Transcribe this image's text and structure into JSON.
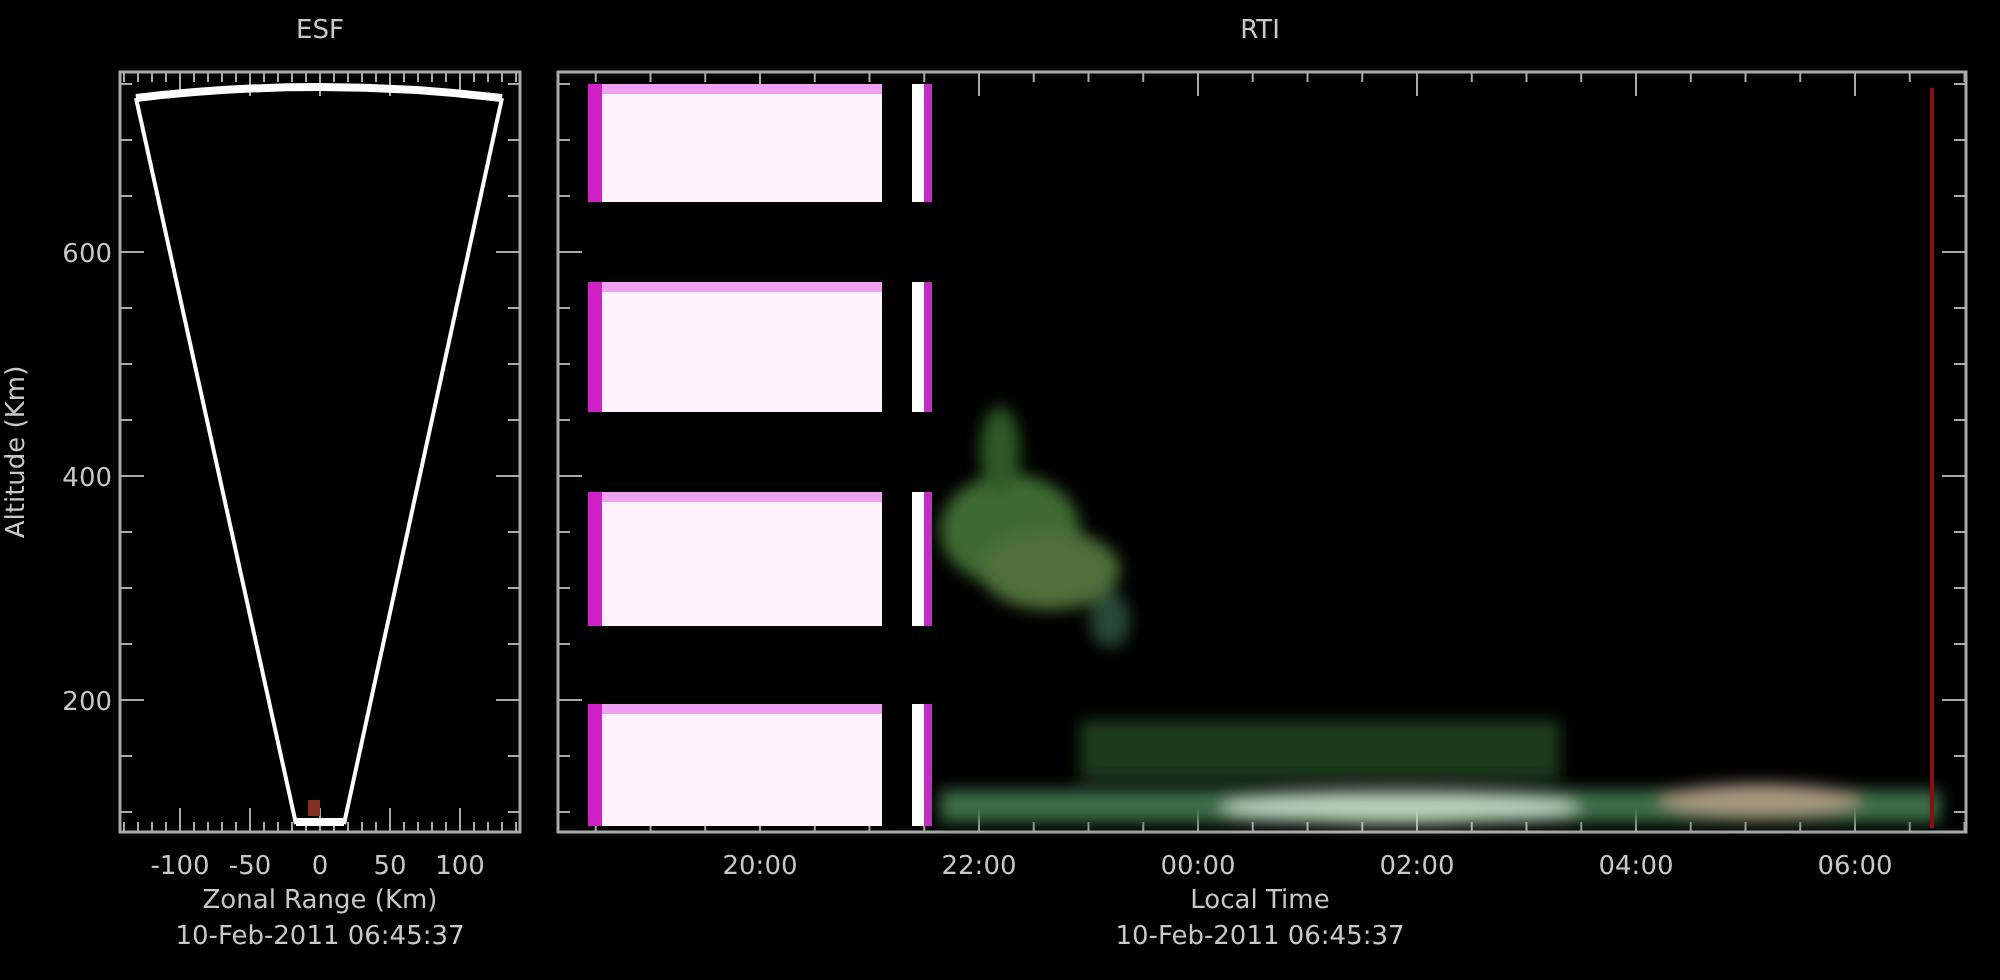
{
  "panels": [
    {
      "kind": "esf",
      "title": "ESF",
      "ylabel": "Altitude (Km)",
      "xlabel": "Zonal Range (Km)",
      "timestamp": "10-Feb-2011 06:45:37",
      "xticks": [
        "-100",
        "-50",
        "0",
        "50",
        "100"
      ],
      "yticks": [
        "600",
        "400",
        "200"
      ]
    },
    {
      "kind": "rti",
      "title": "RTI",
      "xlabel": "Local Time",
      "timestamp": "10-Feb-2011 06:45:37",
      "xticks": [
        "20:00",
        "22:00",
        "00:00",
        "02:00",
        "04:00",
        "06:00"
      ]
    }
  ]
}
